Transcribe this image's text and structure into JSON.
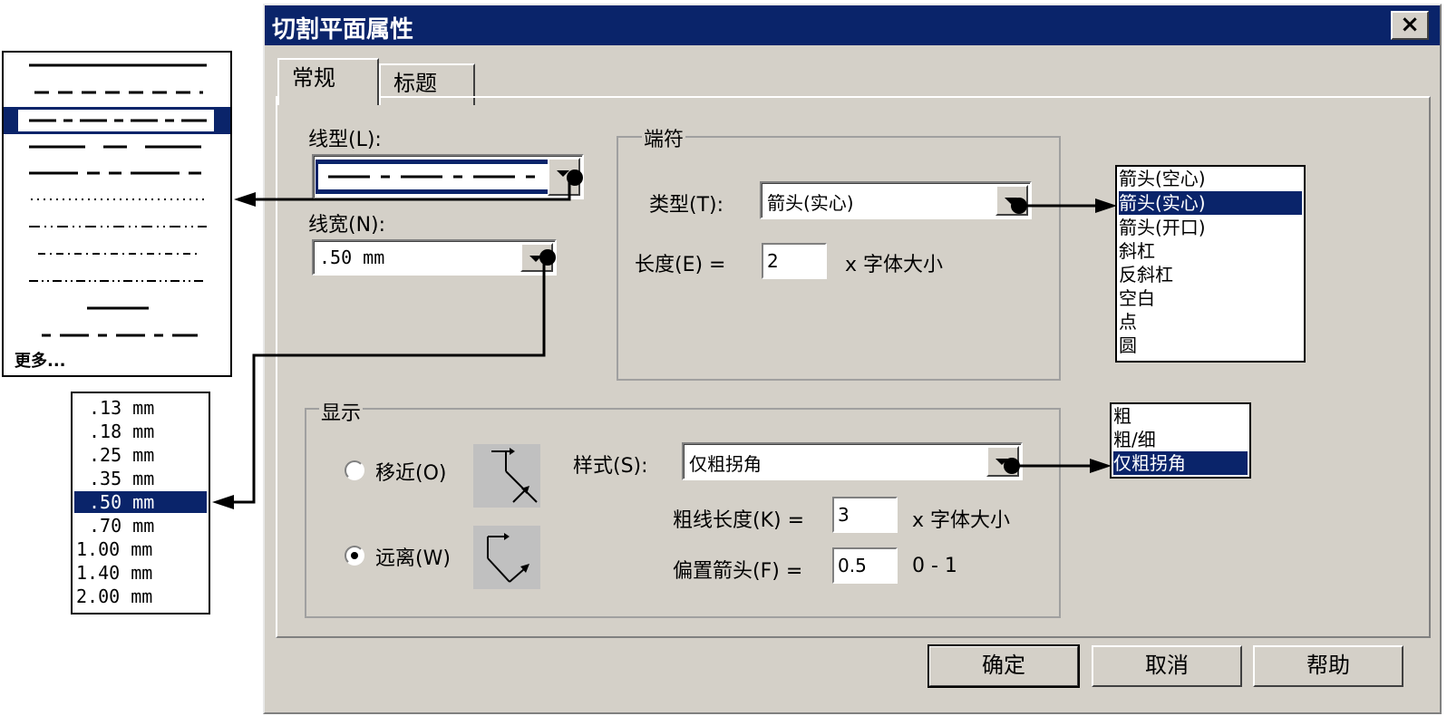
{
  "dialog": {
    "title": "切割平面属性",
    "close_glyph": "×"
  },
  "tabs": [
    {
      "label": "常规"
    },
    {
      "label": "标题"
    }
  ],
  "linetype": {
    "label": "线型(L):",
    "more_label": "更多..."
  },
  "linewidth": {
    "label": "线宽(N):",
    "value": ".50 mm",
    "options": [
      ".13 mm",
      ".18 mm",
      ".25 mm",
      ".35 mm",
      ".50 mm",
      ".70 mm",
      "1.00 mm",
      "1.40 mm",
      "2.00 mm"
    ]
  },
  "endcap": {
    "group_title": "端符",
    "type_label": "类型(T):",
    "type_value": "箭头(实心)",
    "length_label": "长度(E) =",
    "length_value": "2",
    "length_unit": "x 字体大小",
    "options": [
      "箭头(空心)",
      "箭头(实心)",
      "箭头(开口)",
      "斜杠",
      "反斜杠",
      "空白",
      "点",
      "圆"
    ]
  },
  "display": {
    "group_title": "显示",
    "near_label": "移近(O)",
    "far_label": "远离(W)",
    "style_label": "样式(S):",
    "style_value": "仅粗拐角",
    "thick_length_label": "粗线长度(K) =",
    "thick_length_value": "3",
    "thick_length_unit": "x 字体大小",
    "offset_label": "偏置箭头(F) =",
    "offset_value": "0.5",
    "offset_range": "0 - 1",
    "style_options": [
      "粗",
      "粗/细",
      "仅粗拐角"
    ]
  },
  "buttons": {
    "ok": "确定",
    "cancel": "取消",
    "help": "帮助"
  },
  "colors": {
    "titlebar": "#0a246a",
    "dialog_bg": "#d4d0c8",
    "selection": "#0a246a"
  }
}
